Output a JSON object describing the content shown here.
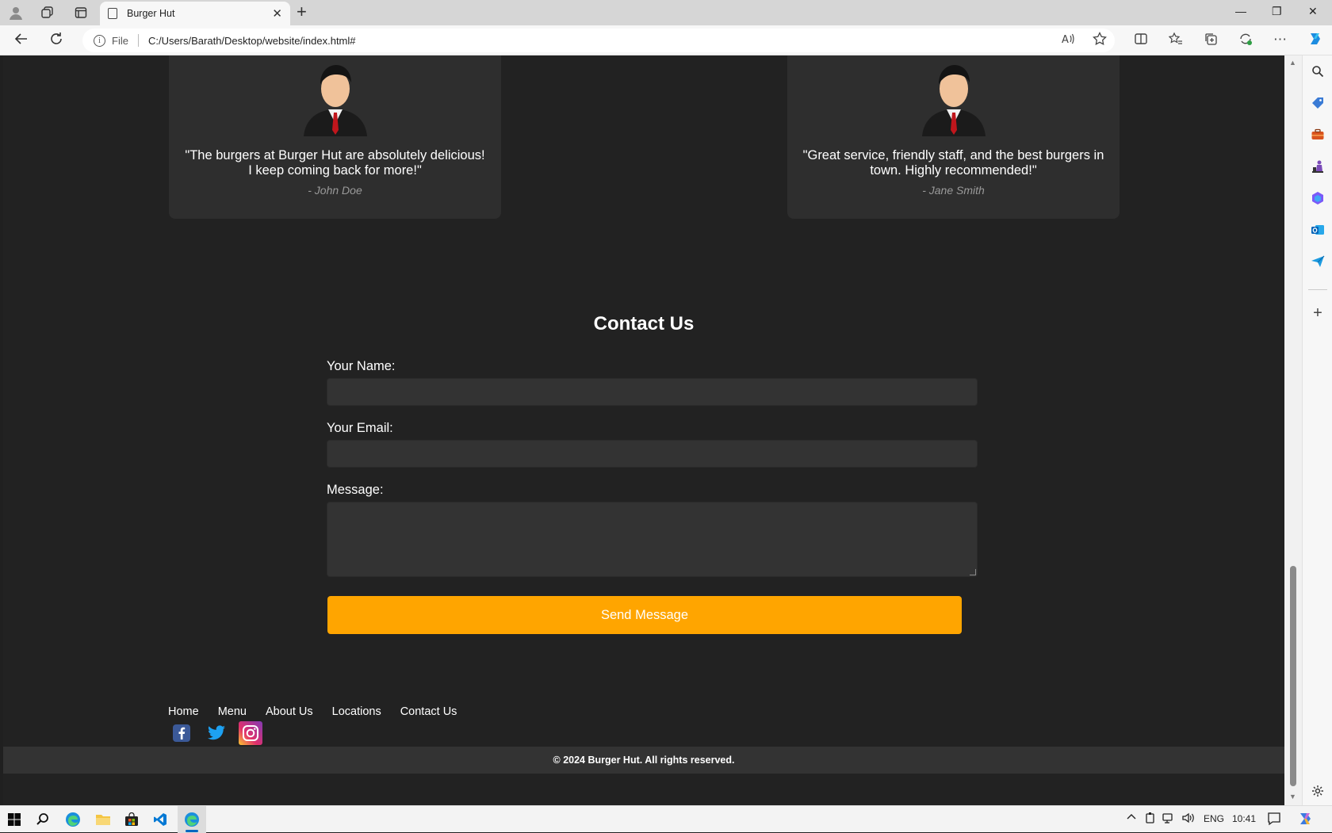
{
  "browser": {
    "tab_title": "Burger Hut",
    "address_prefix": "File",
    "url": "C:/Users/Barath/Desktop/website/index.html#"
  },
  "testimonials": [
    {
      "quote": "\"The burgers at Burger Hut are absolutely delicious! I keep coming back for more!\"",
      "author": "- John Doe"
    },
    {
      "quote": "\"Great service, friendly staff, and the best burgers in town. Highly recommended!\"",
      "author": "- Jane Smith"
    }
  ],
  "contact": {
    "title": "Contact Us",
    "name_label": "Your Name:",
    "name_value": "",
    "email_label": "Your Email:",
    "email_value": "",
    "message_label": "Message:",
    "message_value": "",
    "submit_label": "Send Message"
  },
  "footer": {
    "links": [
      "Home",
      "Menu",
      "About Us",
      "Locations",
      "Contact Us"
    ],
    "social": [
      "facebook-icon",
      "twitter-icon",
      "instagram-icon"
    ],
    "copyright": "© 2024 Burger Hut. All rights reserved."
  },
  "taskbar": {
    "language": "ENG",
    "time": "10:41"
  },
  "colors": {
    "page_bg": "#222222",
    "card_bg": "#2e2e2e",
    "accent": "#ffa500"
  }
}
